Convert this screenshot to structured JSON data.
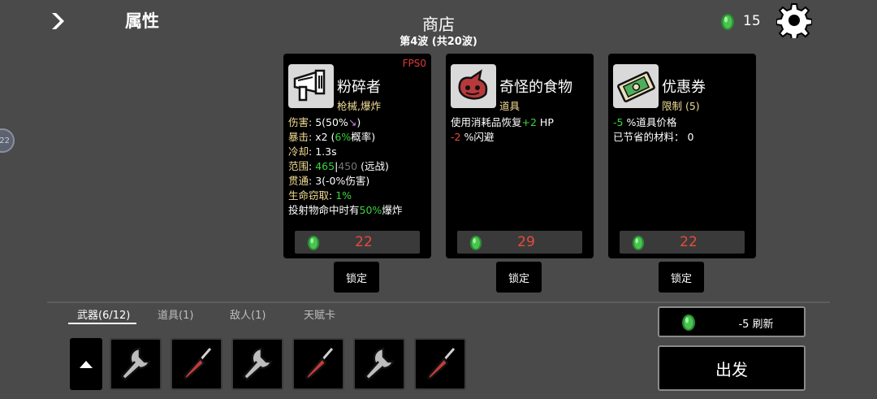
{
  "header": {
    "attributes_title": "属性",
    "shop_title": "商店",
    "wave_text": "第4波 (共20波)",
    "material_count": "15",
    "side_bubble": "22"
  },
  "colors": {
    "gem_green": "#39b54a",
    "price_red": "#e84b3a",
    "stat_green": "#39d63a",
    "label_yellow": "#f2dc95"
  },
  "cards": [
    {
      "name": "粉碎者",
      "sub": "枪械,爆炸",
      "icon": "megaphone-gun-icon",
      "fps": "FPS0",
      "stats": {
        "damage_label": "伤害",
        "damage_value": ": 5(50%",
        "crit_label": "暴击",
        "crit_value_pre": ":  x2 (",
        "crit_pct": "6%",
        "crit_value_post": "概率)",
        "cooldown_label": "冷却",
        "cooldown_value": ": 1.3s",
        "range_label": "范围",
        "range_sep": ": ",
        "range_main": "465",
        "range_bar": "|",
        "range_alt": "450",
        "range_suffix": " (远战)",
        "pierce_label": "贯通",
        "pierce_value": ": 3(-0%伤害)",
        "lifesteal_label": "生命窃取",
        "lifesteal_sep": ": ",
        "lifesteal_value": "1%",
        "explode_pre": "投射物命中时有",
        "explode_pct": "50%",
        "explode_post": "爆炸"
      },
      "price": "22",
      "lock_label": "锁定"
    },
    {
      "name": "奇怪的食物",
      "sub": "道具",
      "icon": "strange-food-icon",
      "stats": {
        "line1_pre": "使用消耗品恢复",
        "line1_val": "+2",
        "line1_post": " HP",
        "line2_val": "-2",
        "line2_post": " %闪避"
      },
      "price": "29",
      "lock_label": "锁定"
    },
    {
      "name": "优惠券",
      "sub": "限制 (5)",
      "icon": "coupon-icon",
      "stats": {
        "line1_val": "-5",
        "line1_post": " %道具价格",
        "line2": "已节省的材料：  0"
      },
      "price": "22",
      "lock_label": "锁定"
    }
  ],
  "tabs": [
    {
      "label": "武器(6/12)",
      "active": true
    },
    {
      "label": "道具(1)",
      "active": false
    },
    {
      "label": "敌人(1)",
      "active": false
    },
    {
      "label": "天赋卡",
      "active": false
    }
  ],
  "inventory": [
    "wrench-icon",
    "screwdriver-icon",
    "wrench-icon",
    "screwdriver-icon",
    "wrench-icon",
    "screwdriver-icon"
  ],
  "refresh": {
    "cost": "-5",
    "label": "刷新"
  },
  "go_label": "出发"
}
